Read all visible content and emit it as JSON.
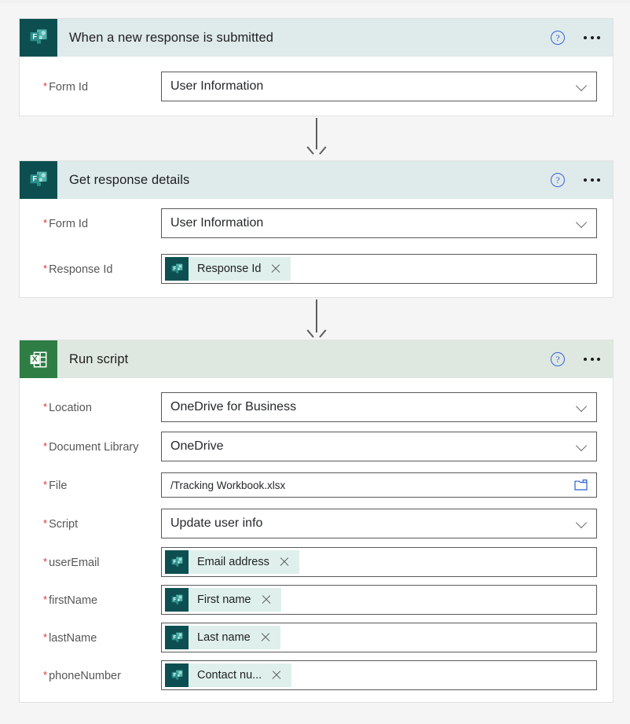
{
  "colors": {
    "forms_brand": "#0d4f51",
    "forms_header_bg": "#dfeaea",
    "excel_brand": "#2d7d45",
    "excel_header_bg": "#dee7e0",
    "token_bg": "#dff0ec",
    "required_asterisk": "#d13438",
    "help_icon": "#3b63d6",
    "canvas_bg": "#f5f5f5"
  },
  "icons": {
    "help": "help-circle-icon",
    "more": "ellipsis-icon",
    "dropdown": "chevron-down-icon",
    "folder": "folder-picker-icon",
    "remove_token": "close-icon",
    "forms_connector": "microsoft-forms-icon",
    "excel_connector": "microsoft-excel-icon",
    "connector_arrow": "arrow-down-icon"
  },
  "help_label": "?",
  "cards": [
    {
      "id": "trigger",
      "title": "When a new response is submitted",
      "connector": "microsoft-forms-icon",
      "fields": [
        {
          "label": "Form Id",
          "required": true,
          "type": "dropdown",
          "value": "User Information"
        }
      ]
    },
    {
      "id": "get-response-details",
      "title": "Get response details",
      "connector": "microsoft-forms-icon",
      "fields": [
        {
          "label": "Form Id",
          "required": true,
          "type": "dropdown",
          "value": "User Information"
        },
        {
          "label": "Response Id",
          "required": true,
          "type": "token",
          "token": "Response Id"
        }
      ]
    },
    {
      "id": "run-script",
      "title": "Run script",
      "connector": "microsoft-excel-icon",
      "fields": [
        {
          "label": "Location",
          "required": true,
          "type": "dropdown",
          "value": "OneDrive for Business"
        },
        {
          "label": "Document Library",
          "required": true,
          "type": "dropdown",
          "value": "OneDrive"
        },
        {
          "label": "File",
          "required": true,
          "type": "filepicker",
          "value": "/Tracking Workbook.xlsx"
        },
        {
          "label": "Script",
          "required": true,
          "type": "dropdown",
          "value": "Update user info"
        },
        {
          "label": "userEmail",
          "required": true,
          "type": "token",
          "token": "Email address"
        },
        {
          "label": "firstName",
          "required": true,
          "type": "token",
          "token": "First name"
        },
        {
          "label": "lastName",
          "required": true,
          "type": "token",
          "token": "Last name"
        },
        {
          "label": "phoneNumber",
          "required": true,
          "type": "token",
          "token": "Contact nu..."
        }
      ]
    }
  ]
}
